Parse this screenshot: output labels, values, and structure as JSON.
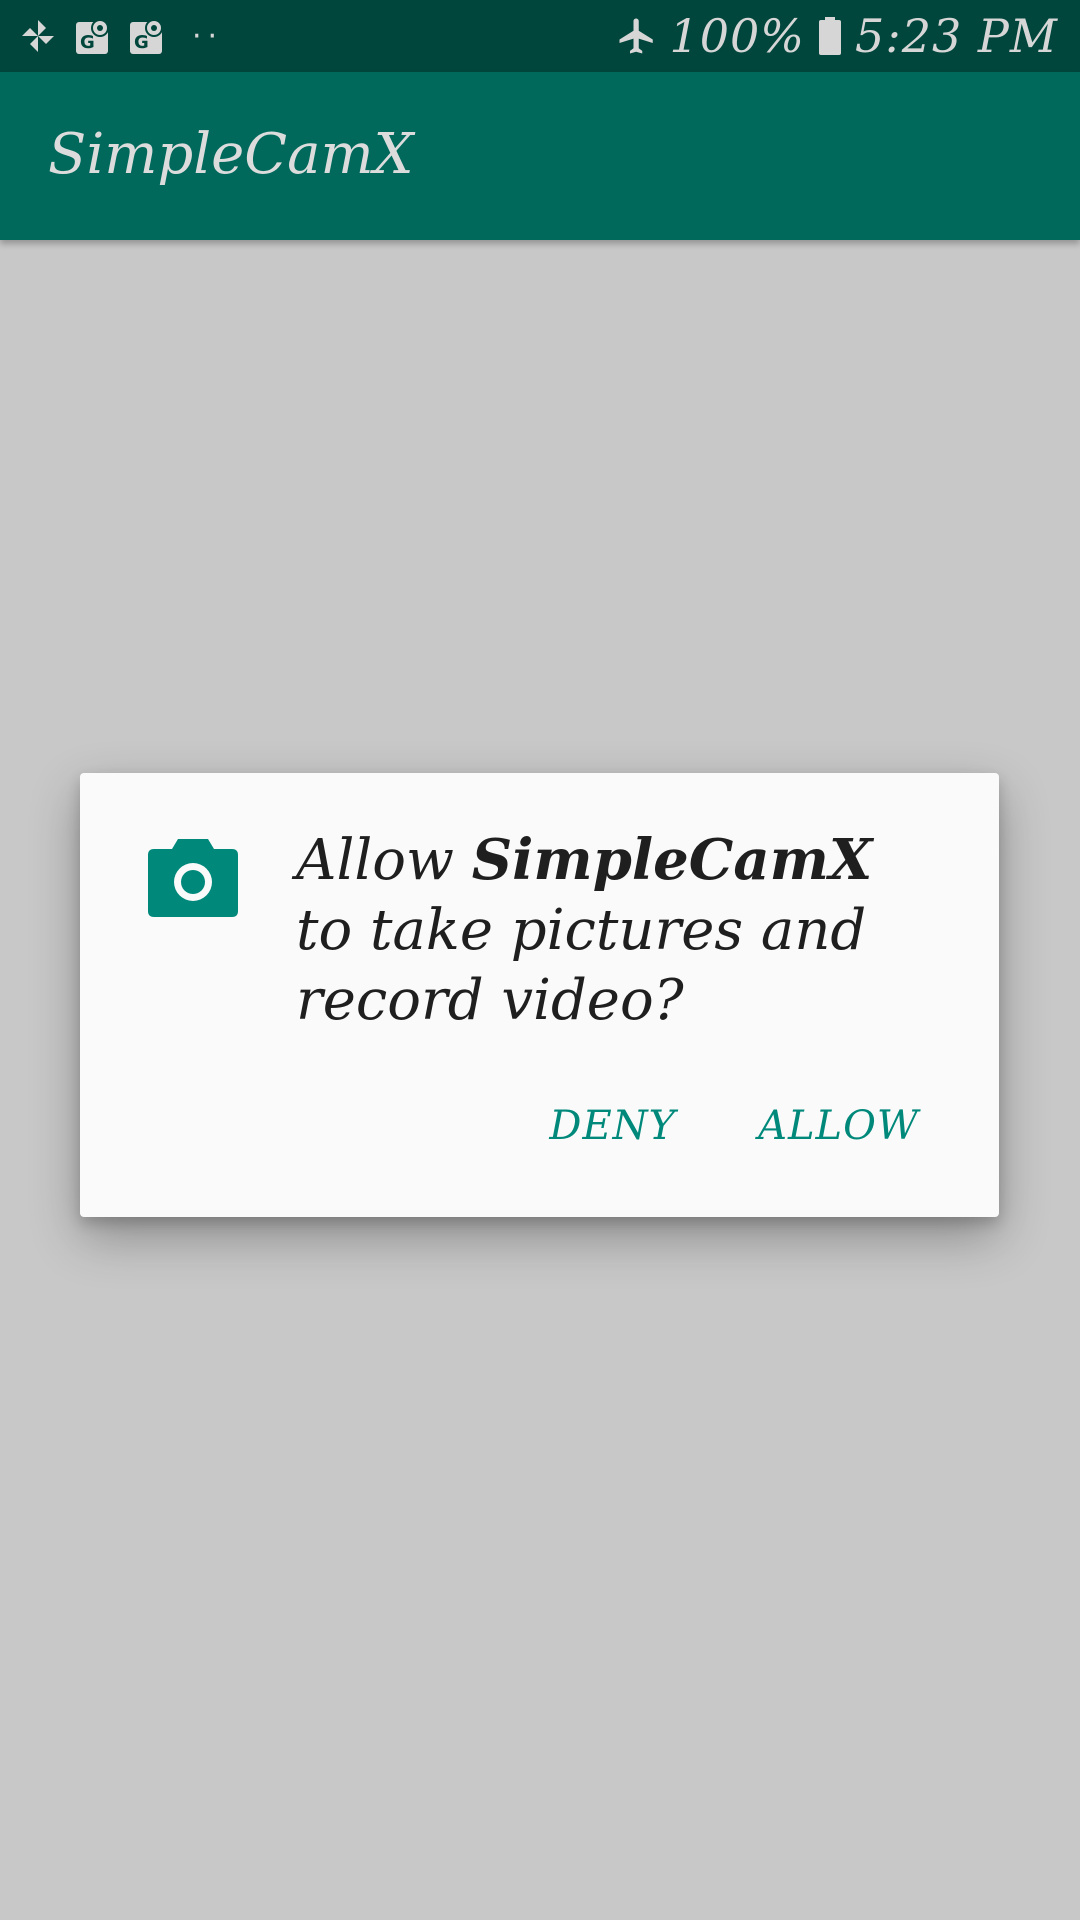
{
  "status_bar": {
    "left_icons": [
      "pinwheel-icon",
      "maps-notification-icon",
      "maps-notification-icon"
    ],
    "more_indicator": "··",
    "airplane_icon": "airplane-icon",
    "battery_percent": "100%",
    "battery_icon": "battery-full-icon",
    "time": "5:23 PM"
  },
  "app_bar": {
    "title": "SimpleCamX"
  },
  "dialog": {
    "icon": "camera-icon",
    "message_prefix": "Allow ",
    "app_name": "SimpleCamX",
    "message_suffix": " to take pictures and record video?",
    "deny_label": "DENY",
    "allow_label": "ALLOW"
  },
  "colors": {
    "status_bar": "#00463c",
    "app_bar": "#00695c",
    "accent": "#00897b",
    "scrim_background": "#c8c8c8",
    "dialog_background": "#fafafa"
  }
}
